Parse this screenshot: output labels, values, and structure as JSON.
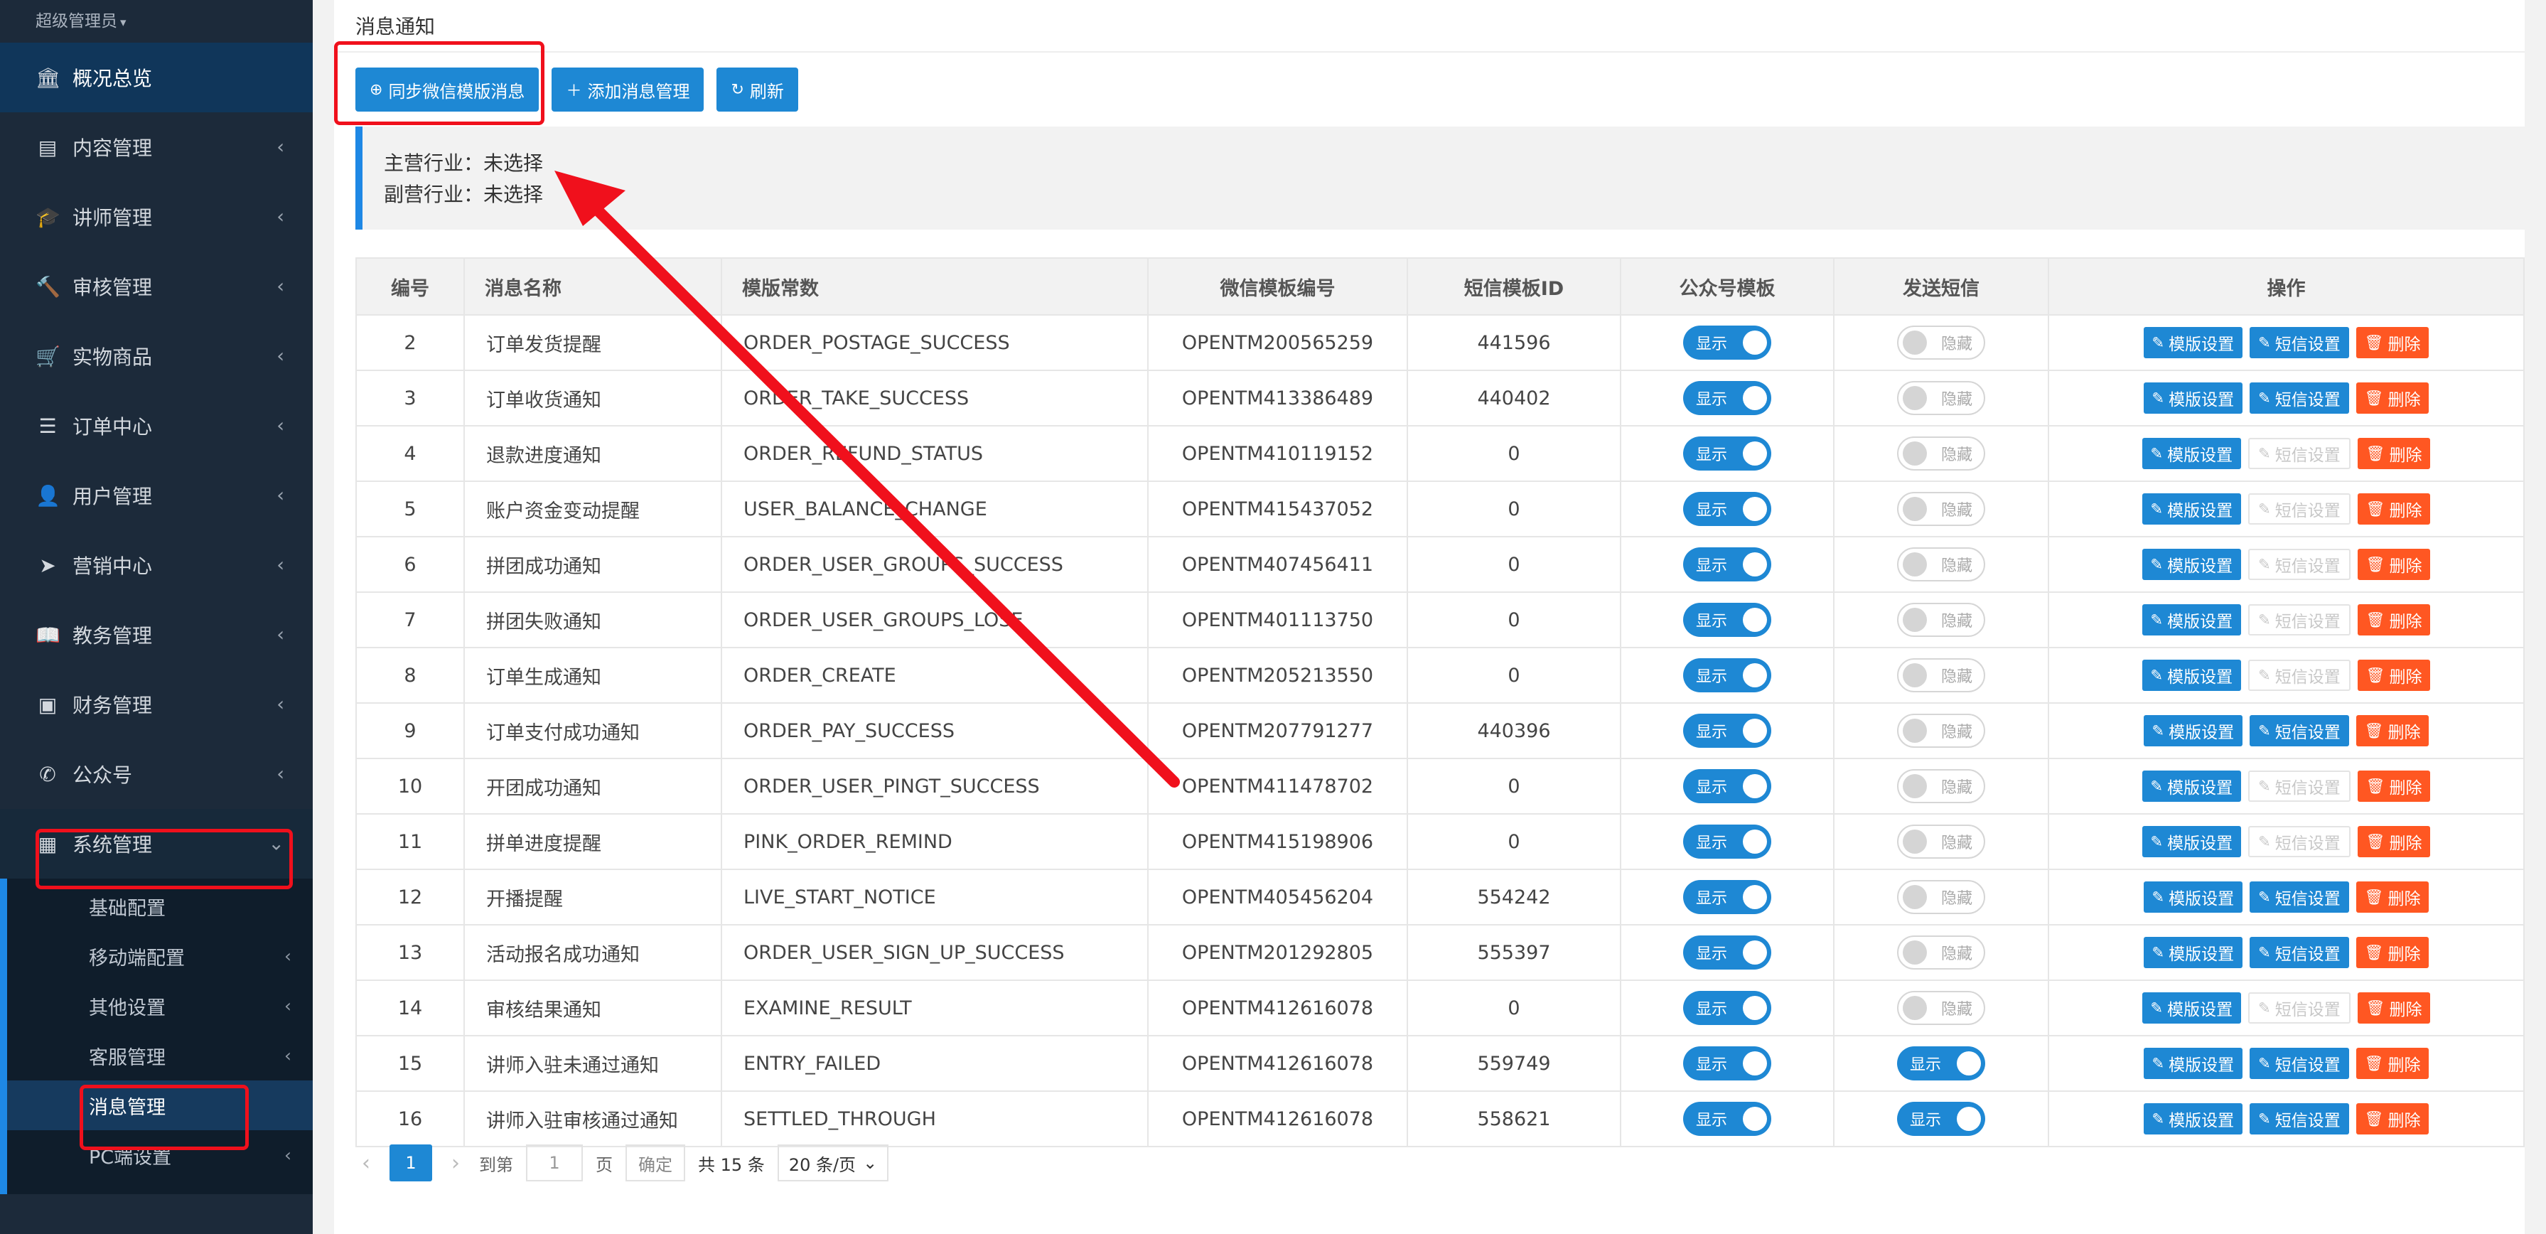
{
  "sidebar": {
    "user": "超级管理员",
    "items": [
      {
        "label": "概况总览",
        "icon": "bank-icon"
      },
      {
        "label": "内容管理",
        "icon": "newspaper-icon"
      },
      {
        "label": "讲师管理",
        "icon": "graduation-cap-icon"
      },
      {
        "label": "审核管理",
        "icon": "gavel-icon"
      },
      {
        "label": "实物商品",
        "icon": "cart-icon"
      },
      {
        "label": "订单中心",
        "icon": "list-icon"
      },
      {
        "label": "用户管理",
        "icon": "user-icon"
      },
      {
        "label": "营销中心",
        "icon": "paper-plane-icon"
      },
      {
        "label": "教务管理",
        "icon": "book-icon"
      },
      {
        "label": "财务管理",
        "icon": "money-icon"
      },
      {
        "label": "公众号",
        "icon": "wechat-icon"
      },
      {
        "label": "系统管理",
        "icon": "grid-icon"
      }
    ],
    "subitems": [
      {
        "label": "基础配置"
      },
      {
        "label": "移动端配置"
      },
      {
        "label": "其他设置"
      },
      {
        "label": "客服管理"
      },
      {
        "label": "消息管理"
      },
      {
        "label": "PC端设置"
      }
    ]
  },
  "page": {
    "title": "消息通知",
    "buttons": {
      "sync": "同步微信模版消息",
      "add": "添加消息管理",
      "refresh": "刷新"
    },
    "info": {
      "primary_label": "主营行业：",
      "primary_value": "未选择",
      "secondary_label": "副营行业：",
      "secondary_value": "未选择"
    }
  },
  "table": {
    "headers": [
      "编号",
      "消息名称",
      "模版常数",
      "微信模板编号",
      "短信模板ID",
      "公众号模板",
      "发送短信",
      "操作"
    ],
    "labels": {
      "show": "显示",
      "hide": "隐藏",
      "tpl_set": "模版设置",
      "sms_set": "短信设置",
      "delete": "删除"
    },
    "rows": [
      {
        "id": "2",
        "name": "订单发货提醒",
        "const": "ORDER_POSTAGE_SUCCESS",
        "wx": "OPENTM200565259",
        "sms": "441596",
        "sms_on": false,
        "sms_btn": true
      },
      {
        "id": "3",
        "name": "订单收货通知",
        "const": "ORDER_TAKE_SUCCESS",
        "wx": "OPENTM413386489",
        "sms": "440402",
        "sms_on": false,
        "sms_btn": true
      },
      {
        "id": "4",
        "name": "退款进度通知",
        "const": "ORDER_REFUND_STATUS",
        "wx": "OPENTM410119152",
        "sms": "0",
        "sms_on": false,
        "sms_btn": false
      },
      {
        "id": "5",
        "name": "账户资金变动提醒",
        "const": "USER_BALANCE_CHANGE",
        "wx": "OPENTM415437052",
        "sms": "0",
        "sms_on": false,
        "sms_btn": false
      },
      {
        "id": "6",
        "name": "拼团成功通知",
        "const": "ORDER_USER_GROUPS_SUCCESS",
        "wx": "OPENTM407456411",
        "sms": "0",
        "sms_on": false,
        "sms_btn": false
      },
      {
        "id": "7",
        "name": "拼团失败通知",
        "const": "ORDER_USER_GROUPS_LOSE",
        "wx": "OPENTM401113750",
        "sms": "0",
        "sms_on": false,
        "sms_btn": false
      },
      {
        "id": "8",
        "name": "订单生成通知",
        "const": "ORDER_CREATE",
        "wx": "OPENTM205213550",
        "sms": "0",
        "sms_on": false,
        "sms_btn": false
      },
      {
        "id": "9",
        "name": "订单支付成功通知",
        "const": "ORDER_PAY_SUCCESS",
        "wx": "OPENTM207791277",
        "sms": "440396",
        "sms_on": false,
        "sms_btn": true
      },
      {
        "id": "10",
        "name": "开团成功通知",
        "const": "ORDER_USER_PINGT_SUCCESS",
        "wx": "OPENTM411478702",
        "sms": "0",
        "sms_on": false,
        "sms_btn": false
      },
      {
        "id": "11",
        "name": "拼单进度提醒",
        "const": "PINK_ORDER_REMIND",
        "wx": "OPENTM415198906",
        "sms": "0",
        "sms_on": false,
        "sms_btn": false
      },
      {
        "id": "12",
        "name": "开播提醒",
        "const": "LIVE_START_NOTICE",
        "wx": "OPENTM405456204",
        "sms": "554242",
        "sms_on": false,
        "sms_btn": true
      },
      {
        "id": "13",
        "name": "活动报名成功通知",
        "const": "ORDER_USER_SIGN_UP_SUCCESS",
        "wx": "OPENTM201292805",
        "sms": "555397",
        "sms_on": false,
        "sms_btn": true
      },
      {
        "id": "14",
        "name": "审核结果通知",
        "const": "EXAMINE_RESULT",
        "wx": "OPENTM412616078",
        "sms": "0",
        "sms_on": false,
        "sms_btn": false
      },
      {
        "id": "15",
        "name": "讲师入驻未通过通知",
        "const": "ENTRY_FAILED",
        "wx": "OPENTM412616078",
        "sms": "559749",
        "sms_on": true,
        "sms_btn": true
      },
      {
        "id": "16",
        "name": "讲师入驻审核通过通知",
        "const": "SETTLED_THROUGH",
        "wx": "OPENTM412616078",
        "sms": "558621",
        "sms_on": true,
        "sms_btn": true
      }
    ]
  },
  "pager": {
    "current": "1",
    "goto_label": "到第",
    "goto_value": "1",
    "page_unit": "页",
    "confirm": "确定",
    "total": "共 15 条",
    "per_page": "20 条/页"
  },
  "colors": {
    "sidebar_bg": "#1c2a3a",
    "primary": "#1e88d4",
    "danger": "#ff5722",
    "annotation": "#f0101c"
  }
}
